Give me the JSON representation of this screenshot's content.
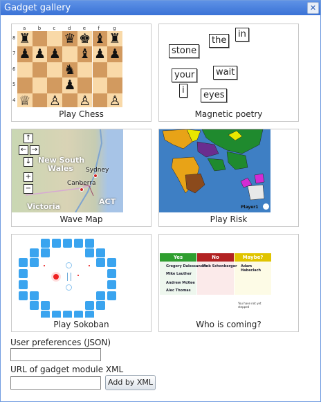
{
  "dialog": {
    "title": "Gadget gallery",
    "close_glyph": "✕"
  },
  "gadgets": [
    {
      "label": "Play Chess"
    },
    {
      "label": "Magnetic poetry"
    },
    {
      "label": "Wave Map"
    },
    {
      "label": "Play Risk"
    },
    {
      "label": "Play Sokoban"
    },
    {
      "label": "Who is coming?"
    }
  ],
  "chess": {
    "files": [
      "a",
      "b",
      "c",
      "d",
      "e",
      "f",
      "g"
    ],
    "ranks": [
      "8",
      "7",
      "6",
      "5",
      "4"
    ],
    "pieces": [
      [
        "♜",
        "",
        "",
        "♛",
        "♚",
        "♝",
        "♜"
      ],
      [
        "♟",
        "♟",
        "♟",
        "",
        "♝",
        "♟",
        "♟"
      ],
      [
        "",
        "",
        "",
        "♞",
        "",
        "",
        ""
      ],
      [
        "",
        "",
        "",
        "♟",
        "",
        "",
        ""
      ],
      [
        "♕",
        "",
        "♙",
        "",
        "♙",
        "",
        "♙"
      ]
    ]
  },
  "poetry": {
    "words": [
      "in",
      "the",
      "stone",
      "wait",
      "your",
      "i",
      "eyes"
    ]
  },
  "wave_map": {
    "regions": [
      "New South",
      "Wales",
      "Victoria",
      "ACT"
    ],
    "cities": [
      "Sydney",
      "Canberra"
    ],
    "controls": [
      "↑",
      "←",
      "→",
      "↓",
      "+",
      "−"
    ]
  },
  "risk": {
    "player_label": "Player1"
  },
  "who_is_coming": {
    "columns": [
      "Yes",
      "No",
      "Maybe?"
    ],
    "yes_names": [
      "Gregory Dalessandro",
      "Mike Lauther",
      "Andrew McKee",
      "Alec Thomas"
    ],
    "no_names": [
      "Rob Schonberger"
    ],
    "maybe_names": [
      "Adam Habeclach"
    ],
    "footer_note": "You have not yet stepped"
  },
  "form": {
    "prefs_label": "User preferences (JSON)",
    "prefs_value": "",
    "url_label": "URL of gadget module XML",
    "url_value": "",
    "add_button_label": "Add by XML"
  },
  "colors": {
    "title_bar": "#3a72d6",
    "yes": "#2f9e2f",
    "no": "#b22222",
    "maybe": "#e0c400"
  }
}
